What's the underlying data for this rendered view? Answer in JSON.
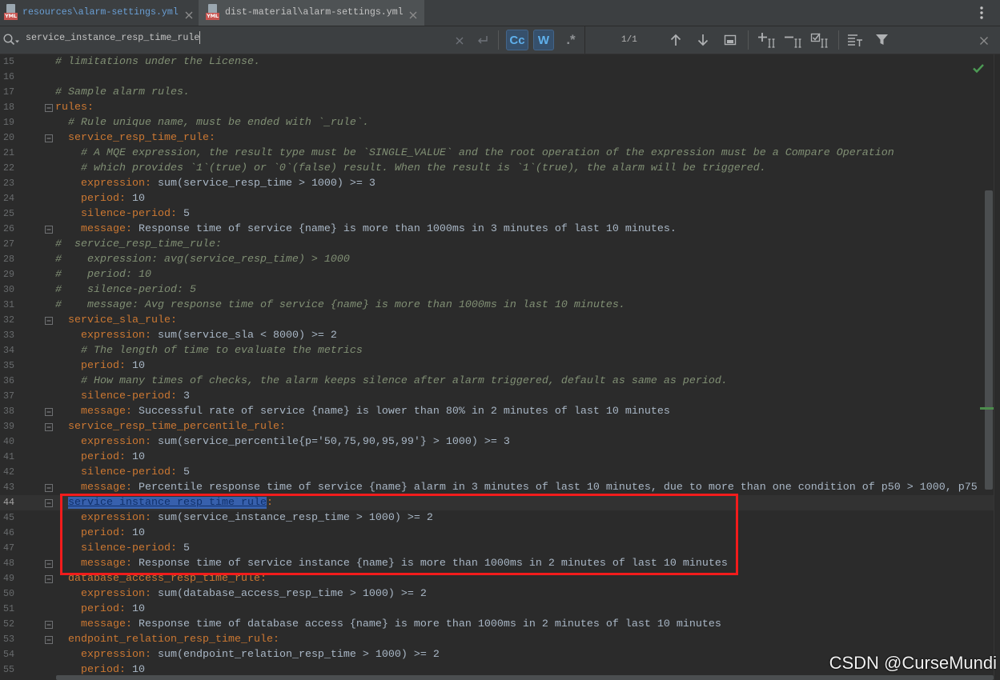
{
  "tabs": [
    {
      "label": "resources\\alarm-settings.yml",
      "icon": "yml-file-icon",
      "active": false
    },
    {
      "label": "dist-material\\alarm-settings.yml",
      "icon": "yml-file-icon",
      "active": true
    }
  ],
  "file_icon_badge": "YML",
  "window_icons": [
    "close-icon",
    "more-options-icon"
  ],
  "search": {
    "query": "service_instance_resp_time_rule",
    "match_case_label": "Cc",
    "match_case_on": true,
    "words_label": "W",
    "words_on": true,
    "regex_label": ".*",
    "regex_on": false,
    "result_count": "1/1",
    "icons": [
      "search-icon",
      "clear-icon",
      "new-line-icon",
      "previous-occurrence-icon",
      "next-occurrence-icon",
      "open-in-window-icon",
      "add-selection-icon",
      "unselect-occurrence-icon",
      "select-all-occurrences-icon",
      "filter-search-results-icon",
      "filter-icon",
      "close-icon"
    ]
  },
  "editor": {
    "inspection_status_icon": "check-icon",
    "lines": [
      {
        "no": "15",
        "segs": [
          {
            "t": "# limitations under the License.",
            "k": "comment"
          }
        ]
      },
      {
        "no": "16",
        "segs": []
      },
      {
        "no": "17",
        "segs": [
          {
            "t": "# Sample alarm rules.",
            "k": "comment"
          }
        ]
      },
      {
        "no": "18",
        "fold": true,
        "segs": [
          {
            "t": "rules:",
            "k": "key"
          }
        ]
      },
      {
        "no": "19",
        "segs": [
          {
            "t": "  # Rule unique name, must be ended with `_rule`.",
            "k": "comment"
          }
        ]
      },
      {
        "no": "20",
        "fold": true,
        "segs": [
          {
            "t": "  service_resp_time_rule:",
            "k": "key"
          }
        ]
      },
      {
        "no": "21",
        "segs": [
          {
            "t": "    # A MQE expression, the result type must be `SINGLE_VALUE` and the root operation of the expression must be a Compare Operation",
            "k": "comment"
          }
        ]
      },
      {
        "no": "22",
        "segs": [
          {
            "t": "    # which provides `1`(true) or `0`(false) result. When the result is `1`(true), the alarm will be triggered.",
            "k": "comment"
          }
        ]
      },
      {
        "no": "23",
        "segs": [
          {
            "t": "    expression:",
            "k": "key"
          },
          {
            "t": " sum(service_resp_time > 1000) >= 3",
            "k": "value"
          }
        ]
      },
      {
        "no": "24",
        "segs": [
          {
            "t": "    period:",
            "k": "key"
          },
          {
            "t": " 10",
            "k": "value"
          }
        ]
      },
      {
        "no": "25",
        "segs": [
          {
            "t": "    silence-period:",
            "k": "key"
          },
          {
            "t": " 5",
            "k": "value"
          }
        ]
      },
      {
        "no": "26",
        "fold": true,
        "segs": [
          {
            "t": "    message:",
            "k": "key"
          },
          {
            "t": " Response time of service {name} is more than 1000ms in 3 minutes of last 10 minutes.",
            "k": "value"
          }
        ]
      },
      {
        "no": "27",
        "segs": [
          {
            "t": "#  service_resp_time_rule:",
            "k": "comment"
          }
        ]
      },
      {
        "no": "28",
        "segs": [
          {
            "t": "#    expression: avg(service_resp_time) > 1000",
            "k": "comment"
          }
        ]
      },
      {
        "no": "29",
        "segs": [
          {
            "t": "#    period: 10",
            "k": "comment"
          }
        ]
      },
      {
        "no": "30",
        "segs": [
          {
            "t": "#    silence-period: 5",
            "k": "comment"
          }
        ]
      },
      {
        "no": "31",
        "segs": [
          {
            "t": "#    message: Avg response time of service {name} is more than 1000ms in last 10 minutes.",
            "k": "comment"
          }
        ]
      },
      {
        "no": "32",
        "fold": true,
        "segs": [
          {
            "t": "  service_sla_rule:",
            "k": "key"
          }
        ]
      },
      {
        "no": "33",
        "segs": [
          {
            "t": "    expression:",
            "k": "key"
          },
          {
            "t": " sum(service_sla < 8000) >= 2",
            "k": "value"
          }
        ]
      },
      {
        "no": "34",
        "segs": [
          {
            "t": "    # The length of time to evaluate the metrics",
            "k": "comment"
          }
        ]
      },
      {
        "no": "35",
        "segs": [
          {
            "t": "    period:",
            "k": "key"
          },
          {
            "t": " 10",
            "k": "value"
          }
        ]
      },
      {
        "no": "36",
        "segs": [
          {
            "t": "    # How many times of checks, the alarm keeps silence after alarm triggered, default as same as period.",
            "k": "comment"
          }
        ]
      },
      {
        "no": "37",
        "segs": [
          {
            "t": "    silence-period:",
            "k": "key"
          },
          {
            "t": " 3",
            "k": "value"
          }
        ]
      },
      {
        "no": "38",
        "fold": true,
        "segs": [
          {
            "t": "    message:",
            "k": "key"
          },
          {
            "t": " Successful rate of service {name} is lower than 80% in 2 minutes of last 10 minutes",
            "k": "value"
          }
        ]
      },
      {
        "no": "39",
        "fold": true,
        "segs": [
          {
            "t": "  service_resp_time_percentile_rule:",
            "k": "key"
          }
        ]
      },
      {
        "no": "40",
        "segs": [
          {
            "t": "    expression:",
            "k": "key"
          },
          {
            "t": " sum(service_percentile{p='50,75,90,95,99'} > 1000) >= 3",
            "k": "value"
          }
        ]
      },
      {
        "no": "41",
        "segs": [
          {
            "t": "    period:",
            "k": "key"
          },
          {
            "t": " 10",
            "k": "value"
          }
        ]
      },
      {
        "no": "42",
        "segs": [
          {
            "t": "    silence-period:",
            "k": "key"
          },
          {
            "t": " 5",
            "k": "value"
          }
        ]
      },
      {
        "no": "43",
        "fold": true,
        "segs": [
          {
            "t": "    message:",
            "k": "key"
          },
          {
            "t": " Percentile response time of service {name} alarm in 3 minutes of last 10 minutes, due to more than one condition of p50 > 1000, p75",
            "k": "value"
          }
        ]
      },
      {
        "no": "44",
        "fold": true,
        "current": true,
        "segs": [
          {
            "t": "  ",
            "k": "plain"
          },
          {
            "t": "service_instance_resp_time_rule",
            "k": "match"
          },
          {
            "t": ":",
            "k": "key"
          }
        ]
      },
      {
        "no": "45",
        "segs": [
          {
            "t": "    expression:",
            "k": "key"
          },
          {
            "t": " sum(service_instance_resp_time > 1000) >= 2",
            "k": "value"
          }
        ]
      },
      {
        "no": "46",
        "segs": [
          {
            "t": "    period:",
            "k": "key"
          },
          {
            "t": " 10",
            "k": "value"
          }
        ]
      },
      {
        "no": "47",
        "segs": [
          {
            "t": "    silence-period:",
            "k": "key"
          },
          {
            "t": " 5",
            "k": "value"
          }
        ]
      },
      {
        "no": "48",
        "fold": true,
        "segs": [
          {
            "t": "    message:",
            "k": "key"
          },
          {
            "t": " Response time of service instance {name} is more than 1000ms in 2 minutes of last 10 minutes",
            "k": "value"
          }
        ]
      },
      {
        "no": "49",
        "fold": true,
        "segs": [
          {
            "t": "  database_access_resp_time_rule:",
            "k": "key"
          }
        ]
      },
      {
        "no": "50",
        "segs": [
          {
            "t": "    expression:",
            "k": "key"
          },
          {
            "t": " sum(database_access_resp_time > 1000) >= 2",
            "k": "value"
          }
        ]
      },
      {
        "no": "51",
        "segs": [
          {
            "t": "    period:",
            "k": "key"
          },
          {
            "t": " 10",
            "k": "value"
          }
        ]
      },
      {
        "no": "52",
        "fold": true,
        "segs": [
          {
            "t": "    message:",
            "k": "key"
          },
          {
            "t": " Response time of database access {name} is more than 1000ms in 2 minutes of last 10 minutes",
            "k": "value"
          }
        ]
      },
      {
        "no": "53",
        "fold": true,
        "segs": [
          {
            "t": "  endpoint_relation_resp_time_rule:",
            "k": "key"
          }
        ]
      },
      {
        "no": "54",
        "segs": [
          {
            "t": "    expression:",
            "k": "key"
          },
          {
            "t": " sum(endpoint_relation_resp_time > 1000) >= 2",
            "k": "value"
          }
        ]
      },
      {
        "no": "55",
        "segs": [
          {
            "t": "    period:",
            "k": "key"
          },
          {
            "t": " 10",
            "k": "value"
          }
        ]
      }
    ]
  },
  "watermark": "CSDN @CurseMundi",
  "colors": {
    "editor_background": "#2b2b2b",
    "toolbar_background": "#3c3f41",
    "yaml_key": "#cc7832",
    "yaml_value": "#a9b7c6",
    "comment": "#808f74",
    "search_match": "#3760ad",
    "annotation_red": "#f21c1c",
    "inspection_ok_green": "#4c9a54"
  }
}
